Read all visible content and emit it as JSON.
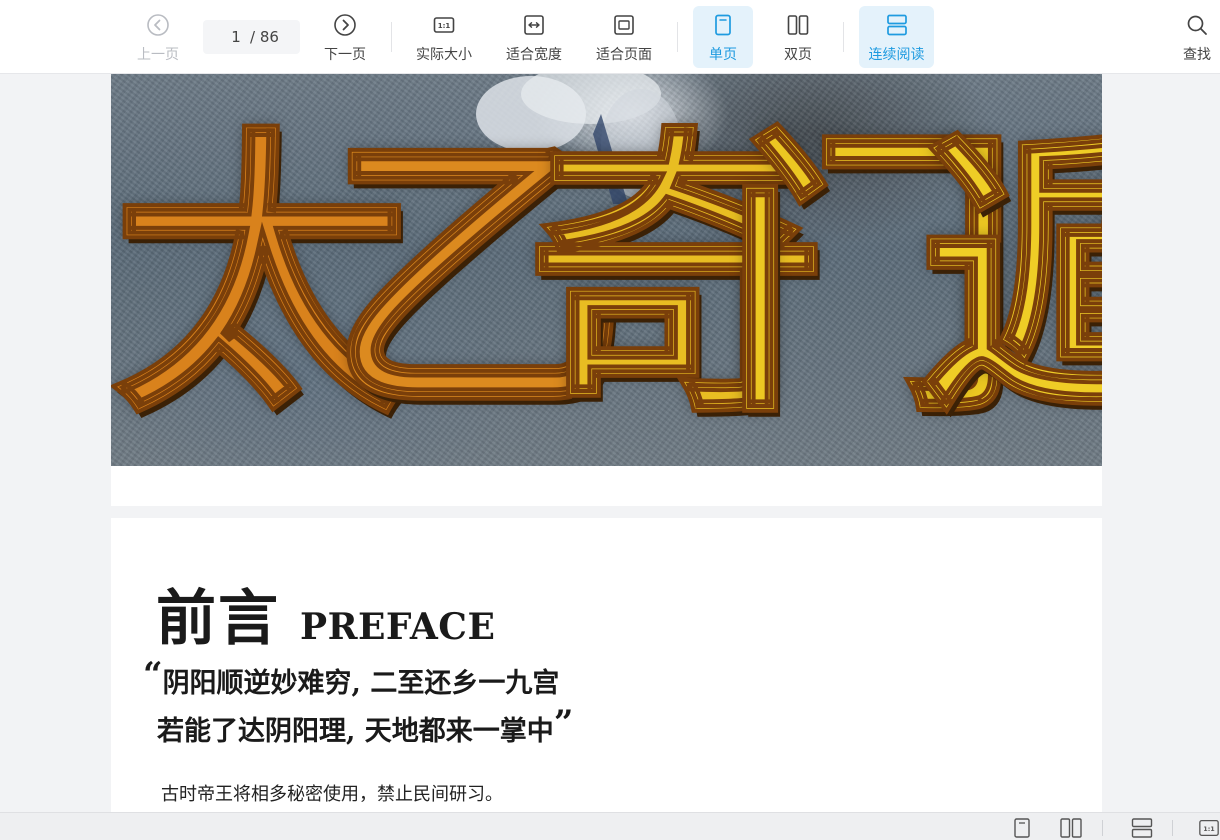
{
  "toolbar": {
    "prev_page": "上一页",
    "next_page": "下一页",
    "actual_size": "实际大小",
    "actual_size_glyph": "1:1",
    "fit_width": "适合宽度",
    "fit_page": "适合页面",
    "single_page": "单页",
    "double_page": "双页",
    "continuous": "连续阅读",
    "find": "查找",
    "current_page": "1",
    "total_pages": "/ 86"
  },
  "document": {
    "cover_title_chars": [
      "太",
      "乙",
      "奇",
      "门",
      "遁"
    ],
    "preface_cn": "前言",
    "preface_en": "PREFACE",
    "quote_open": "“",
    "quote_line1": "阴阳顺逆妙难穷, 二至还乡一九宫",
    "quote_line2": "若能了达阴阳理, 天地都来一掌中",
    "quote_close": "”",
    "body_line1": "古时帝王将相多秘密使用，禁止民间研习。"
  },
  "statusbar": {
    "zoom_glyph": "1:1"
  },
  "colors": {
    "accent": "#1e9be0",
    "active_bg": "#e4f2fb",
    "disabled": "#b9bcc2"
  }
}
